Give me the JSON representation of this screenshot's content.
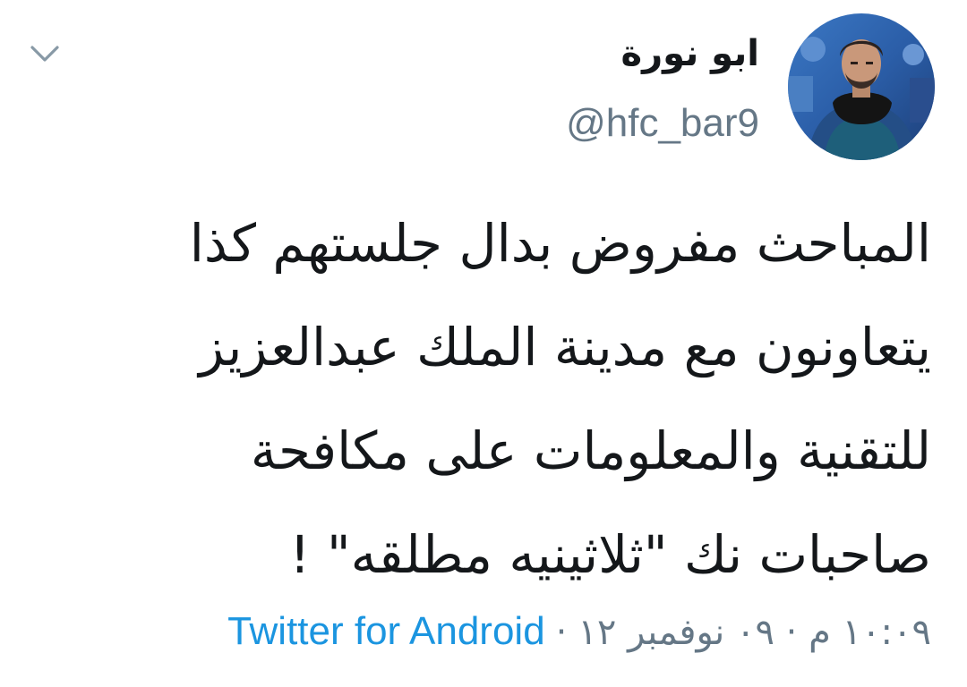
{
  "author": {
    "display_name": "ابو نورة",
    "handle": "@hfc_bar9",
    "avatar_icon": "profile-photo"
  },
  "tweet": {
    "lines": [
      "المباحث مفروض بدال جلستهم كذا",
      "يتعاونون مع مدينة الملك عبدالعزيز",
      "للتقنية والمعلومات على مكافحة",
      "صاحبات نك \"ثلاثينيه مطلقه\" !"
    ]
  },
  "meta": {
    "timestamp": "١٠:٠٩ م · ٠٩ نوفمبر ١٢",
    "separator": "·",
    "source": "Twitter for Android"
  },
  "icons": {
    "menu": "chevron-down-icon"
  },
  "colors": {
    "text": "#14171a",
    "secondary": "#657786",
    "link": "#1b95e0",
    "background": "#ffffff"
  }
}
